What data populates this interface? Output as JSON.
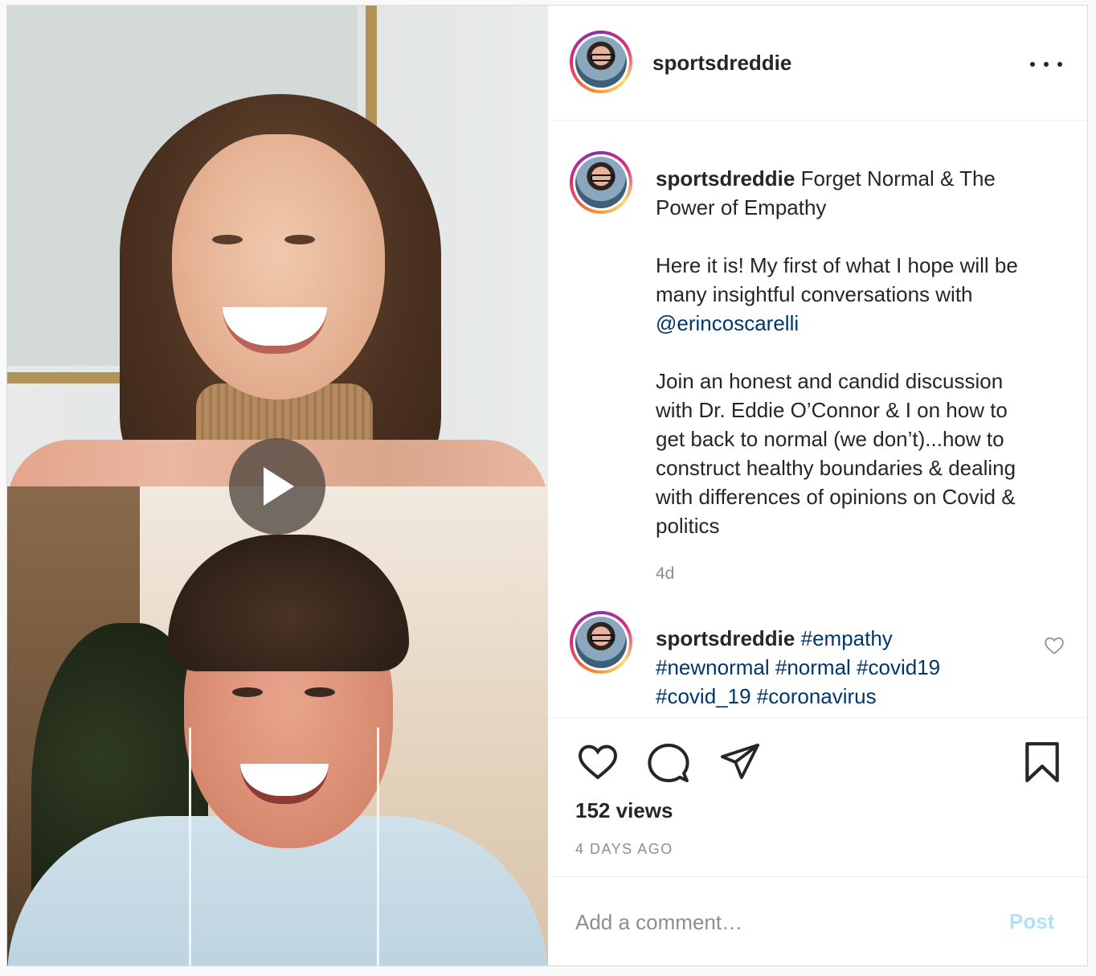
{
  "post": {
    "username": "sportsdreddie",
    "header_more_icon": "more-horizontal-icon"
  },
  "caption": {
    "username": "sportsdreddie",
    "line1": "Forget Normal & The",
    "line2": "Power of Empathy",
    "p2_line1": "Here it is! My first of what I hope will be",
    "p2_line2": "many insightful conversations with",
    "mention": "@erincoscarelli",
    "p3_line1": "Join an honest and candid discussion",
    "p3_line2": "with Dr. Eddie O’Connor & I on how to",
    "p3_line3": "get back to normal (we don’t)...how to",
    "p3_line4": "construct healthy boundaries & dealing",
    "p3_line5": "with differences of opinions on Covid &",
    "p3_line6": "politics",
    "time": "4d"
  },
  "comment": {
    "username": "sportsdreddie",
    "tag1": "#empathy",
    "tag2": "#newnormal",
    "tag3": "#normal",
    "tag4": "#covid19",
    "tag5": "#covid_19",
    "tag6": "#coronavirus"
  },
  "actions": {
    "like_icon": "heart-icon",
    "comment_icon": "comment-bubble-icon",
    "share_icon": "paper-plane-icon",
    "save_icon": "bookmark-icon",
    "views": "152 views",
    "ago": "4 DAYS AGO"
  },
  "composer": {
    "placeholder": "Add a comment…",
    "post_label": "Post"
  },
  "colors": {
    "link": "#00376b",
    "post_button_disabled": "#b2dffc",
    "muted": "#8e8e8e"
  }
}
